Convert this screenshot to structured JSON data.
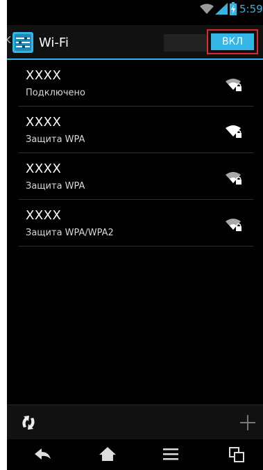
{
  "status_bar": {
    "time": "5:59",
    "wifi_icon": "wifi-icon",
    "signal_icon": "signal-icon",
    "battery_icon": "battery-charging-icon",
    "accent_color": "#33b5e5"
  },
  "action_bar": {
    "title": "Wi-Fi",
    "app_icon": "wifi-settings-icon",
    "toggle_label": "ВКЛ",
    "toggle_color": "#33b5e5",
    "highlight_color": "#e0282e"
  },
  "networks": [
    {
      "ssid": "XXXX",
      "status": "Подключено",
      "icon": "wifi-locked-icon"
    },
    {
      "ssid": "XXXX",
      "status": "Защита WPA",
      "icon": "wifi-locked-icon"
    },
    {
      "ssid": "XXXX",
      "status": "Защита WPA",
      "icon": "wifi-locked-icon"
    },
    {
      "ssid": "XXXX",
      "status": "Защита WPA/WPA2",
      "icon": "wifi-locked-icon"
    }
  ],
  "bottom_actions": {
    "left_icon": "wps-icon",
    "right_icon": "plus-icon"
  },
  "nav_bar": {
    "back_icon": "back-icon",
    "home_icon": "home-icon",
    "menu_icon": "menu-icon",
    "recents_icon": "recents-icon"
  }
}
